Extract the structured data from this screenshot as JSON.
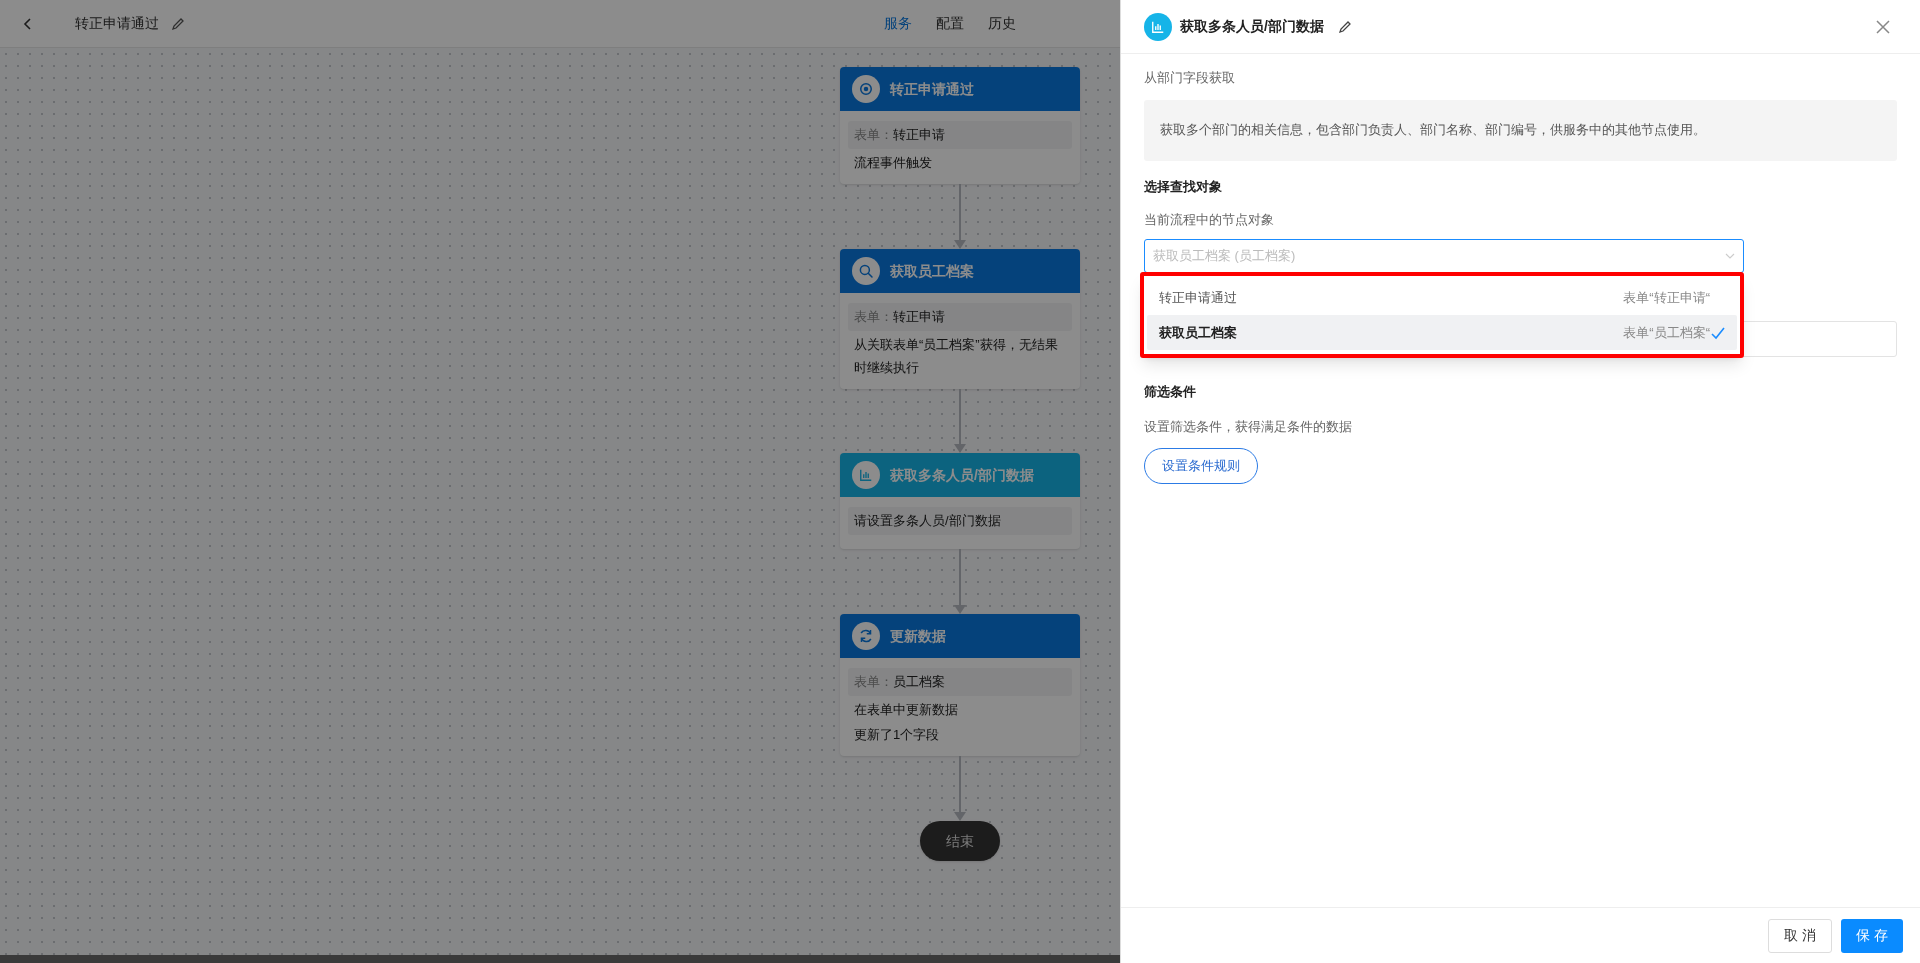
{
  "header": {
    "title": "转正申请通过",
    "tabs": [
      {
        "label": "服务",
        "selected": true
      },
      {
        "label": "配置",
        "selected": false
      },
      {
        "label": "历史",
        "selected": false
      }
    ]
  },
  "flow": {
    "nodes": [
      {
        "kind": "trigger",
        "title": "转正申请通过",
        "form_label": "表单：",
        "form_value": "转正申请",
        "lines": [
          "流程事件触发"
        ]
      },
      {
        "kind": "search",
        "title": "获取员工档案",
        "form_label": "表单：",
        "form_value": "转正申请",
        "lines": [
          "从关联表单“员工档案”获得，无结果时继续执行"
        ]
      },
      {
        "kind": "chart",
        "title": "获取多条人员/部门数据",
        "note": "请设置多条人员/部门数据"
      },
      {
        "kind": "refresh",
        "title": "更新数据",
        "form_label": "表单：",
        "form_value": "员工档案",
        "lines": [
          "在表单中更新数据",
          "更新了1个字段"
        ]
      }
    ],
    "end": "结束"
  },
  "panel": {
    "title": "获取多条人员/部门数据",
    "subtitle": "从部门字段获取",
    "description": "获取多个部门的相关信息，包含部门负责人、部门名称、部门编号，供服务中的其他节点使用。",
    "section_title": "选择查找对象",
    "field_label": "当前流程中的节点对象",
    "select_value": "获取员工档案 (员工档案)",
    "dropdown": [
      {
        "label": "转正申请通过",
        "hint": "表单“转正申请“",
        "selected": false
      },
      {
        "label": "获取员工档案",
        "hint": "表单“员工档案“",
        "selected": true
      }
    ],
    "filter_title": "筛选条件",
    "filter_description": "设置筛选条件，获得满足条件的数据",
    "filter_button": "设置条件规则",
    "buttons": {
      "cancel": "取 消",
      "save": "保 存"
    }
  }
}
